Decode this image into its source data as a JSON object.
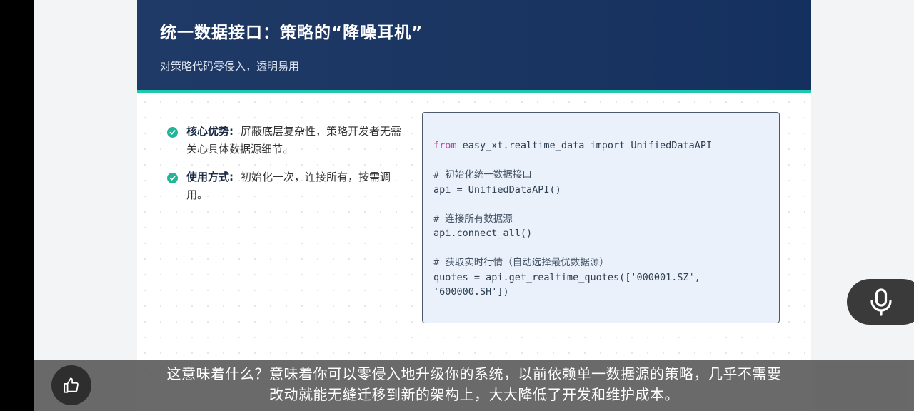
{
  "slide": {
    "title": "统一数据接口：策略的“降噪耳机”",
    "subtitle": "对策略代码零侵入，透明易用",
    "points": [
      {
        "title": "核心优势:",
        "text": "屏蔽底层复杂性，策略开发者无需关心具体数据源细节。"
      },
      {
        "title": "使用方式:",
        "text": "初始化一次，连接所有，按需调用。"
      }
    ],
    "code": {
      "line1_keyword": "from",
      "line1_rest": " easy_xt.realtime_data import UnifiedDataAPI",
      "comment1": "# 初始化统一数据接口",
      "line2": "api = UnifiedDataAPI()",
      "comment2": "# 连接所有数据源",
      "line3": "api.connect_all()",
      "comment3": "# 获取实时行情（自动选择最优数据源）",
      "line4": "quotes = api.get_realtime_quotes(['000001.SZ',",
      "line5": "'600000.SH'])"
    }
  },
  "caption": {
    "line1": "这意味着什么？意味着你可以零侵入地升级你的系统，以前依赖单一数据源的策略，几乎不需要",
    "line2": "改动就能无缝迁移到新的架构上，大大降低了开发和维护成本。"
  },
  "icons": {
    "like": "thumbs-up-icon",
    "mic": "microphone-icon",
    "check": "check-circle-icon"
  },
  "colors": {
    "header_bg": "#1b3562",
    "accent": "#1ec8b0",
    "check": "#22b59a",
    "code_bg": "#eaf1fb",
    "keyword": "#c2409a"
  }
}
